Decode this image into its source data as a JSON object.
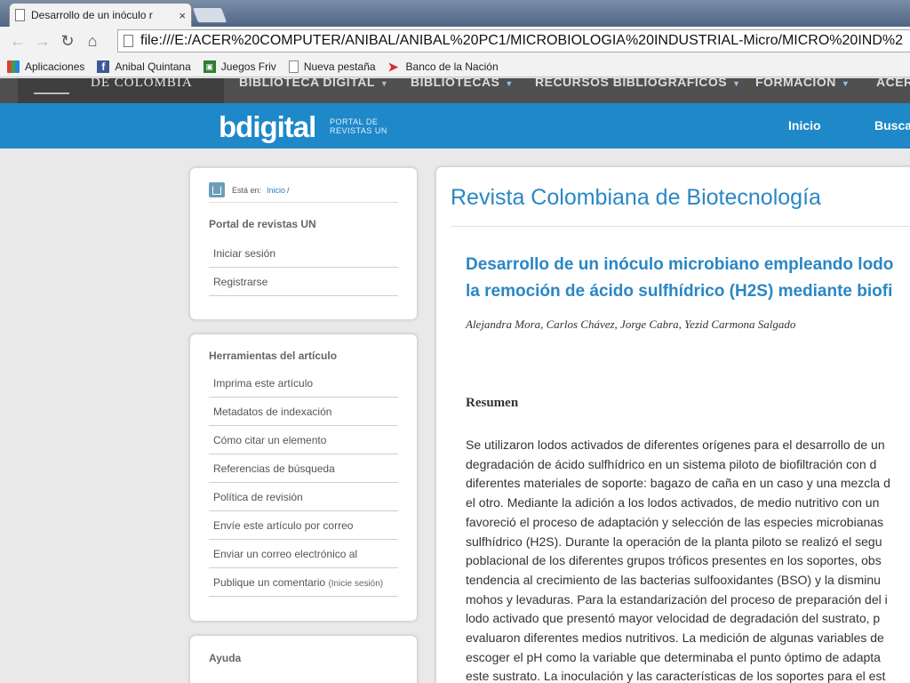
{
  "browser": {
    "tab_title": "Desarrollo de un inóculo r",
    "tab_close": "×",
    "url": "file:///E:/ACER%20COMPUTER/ANIBAL/ANIBAL%20PC1/MICROBIOLOGIA%20INDUSTRIAL-Micro/MICRO%20IND%2",
    "nav_icons": [
      "back-arrow-icon",
      "forward-arrow-icon",
      "reload-icon",
      "home-icon"
    ],
    "bookmarks": [
      {
        "label": "Aplicaciones",
        "icon": "apps-grid-icon"
      },
      {
        "label": "Anibal Quintana",
        "icon": "facebook-icon"
      },
      {
        "label": "Juegos Friv",
        "icon": "friv-icon"
      },
      {
        "label": "Nueva pestaña",
        "icon": "page-icon"
      },
      {
        "label": "Banco de la Nación",
        "icon": "banco-nacion-icon"
      }
    ]
  },
  "site": {
    "logo_text": "DE COLOMBIA",
    "top_menu": [
      "BIBLIOTECA DIGITAL",
      "BIBLIOTECAS",
      "RECURSOS BIBLIOGRÁFICOS",
      "FORMACIÓN",
      "ACER"
    ],
    "brand": "bdigital",
    "brand_sub_1": "PORTAL DE",
    "brand_sub_2": "REVISTAS UN",
    "blue_menu": [
      "Inicio",
      "Busca"
    ]
  },
  "sidebar": {
    "breadcrumb_label": "Está en:",
    "breadcrumb_link": "Inicio",
    "breadcrumb_sep": "/",
    "portal_title": "Portal de revistas UN",
    "portal_items": [
      "Iniciar sesión",
      "Registrarse"
    ],
    "tools_title": "Herramientas del artículo",
    "tools_items": [
      "Imprima este artículo",
      "Metadatos de indexación",
      "Cómo citar un elemento",
      "Referencias de búsqueda",
      "Política de revisión",
      "Envíe este artículo por correo",
      "Enviar un correo electrónico al",
      "Publique un comentario"
    ],
    "comment_note": "(Inicie sesión)",
    "help_title": "Ayuda"
  },
  "article": {
    "journal": "Revista Colombiana de Biotecnología",
    "title_line1": "Desarrollo de un inóculo microbiano empleando lodo",
    "title_line2": "la remoción de ácido sulfhídrico (H2S) mediante biofi",
    "authors": "Alejandra Mora, Carlos Chávez, Jorge Cabra, Yezid Carmona Salgado",
    "abstract_heading": "Resumen",
    "abstract_lines": [
      "Se utilizaron lodos activados de diferentes orígenes para el desarrollo de un",
      "degradación de ácido sulfhídrico en un sistema piloto de biofiltración con d",
      "diferentes materiales de soporte: bagazo de caña en un caso y una mezcla d",
      "el otro. Mediante la adición a los lodos activados, de medio nutritivo con un",
      "favoreció el proceso de adaptación y selección de las especies microbianas",
      "sulfhídrico (H2S). Durante la operación de la planta piloto se realizó el segu",
      "poblacional de los diferentes grupos tróficos presentes en los soportes, obs",
      "tendencia al crecimiento de las bacterias sulfooxidantes (BSO) y la disminu",
      "mohos y levaduras. Para la estandarización del proceso de preparación del i",
      "lodo activado que presentó mayor velocidad de degradación del sustrato, p",
      "evaluaron diferentes medios nutritivos. La medición de algunas variables de",
      "escoger el pH como la variable que determinaba el punto óptimo de adapta",
      "este sustrato. La inoculación y las características de los soportes para el est"
    ]
  }
}
